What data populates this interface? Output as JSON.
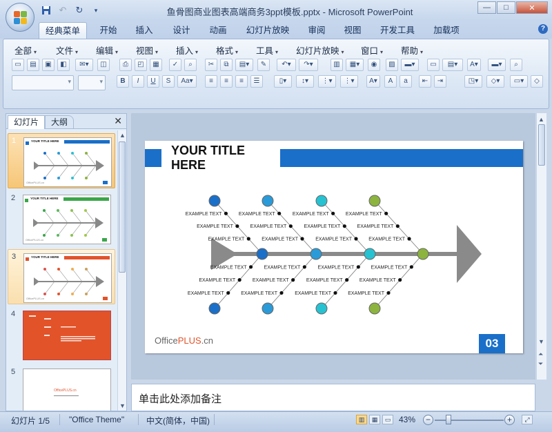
{
  "window": {
    "title": "鱼骨图商业图表高端商务3ppt模板.pptx - Microsoft PowerPoint",
    "controls": [
      "—",
      "□",
      "✕"
    ]
  },
  "ribbon_tabs": [
    "经典菜单",
    "开始",
    "插入",
    "设计",
    "动画",
    "幻灯片放映",
    "审阅",
    "视图",
    "开发工具",
    "加载项"
  ],
  "active_tab": "经典菜单",
  "menu_bar": [
    "全部",
    "文件",
    "编辑",
    "视图",
    "插入",
    "格式",
    "工具",
    "幻灯片放映",
    "窗口",
    "帮助"
  ],
  "pane": {
    "tabs": [
      "幻灯片",
      "大纲"
    ],
    "close_glyph": "✕",
    "thumbnails": [
      {
        "num": "1",
        "accent": "#1a6fc9",
        "title": "YOUR TITLE HERE",
        "logo": "OfficePLUS.cn"
      },
      {
        "num": "2",
        "accent": "#3aa64a",
        "title": "YOUR TITLE HERE",
        "logo": "OfficePLUS.cn"
      },
      {
        "num": "3",
        "accent": "#e2532a",
        "title": "YOUR TITLE HERE",
        "logo": "OfficePLUS.cn"
      },
      {
        "num": "4",
        "accent": "#e2532a",
        "title": "",
        "logo": ""
      },
      {
        "num": "5",
        "accent": "#ffffff",
        "title": "",
        "logo": "OfficePLUS.cn"
      }
    ]
  },
  "slide": {
    "title_line1": "YOUR TITLE",
    "title_line2": "HERE",
    "accent_color": "#1a6fc9",
    "bone_color": "#8a8a8a",
    "label": "EXAMPLE TEXT",
    "logo_prefix": "Office",
    "logo_accent": "PLUS",
    "logo_suffix": ".cn",
    "page_number": "03",
    "node_colors": [
      "#1a6fc9",
      "#2a9bd8",
      "#27c2d2",
      "#8cb43e"
    ],
    "spine_node_colors": [
      "#1a6fc9",
      "#2a9bd8",
      "#27c2d2",
      "#8cb43e"
    ]
  },
  "notes_placeholder": "单击此处添加备注",
  "status": {
    "slide_info": "幻灯片 1/5",
    "theme": "\"Office Theme\"",
    "language": "中文(简体，中国)",
    "zoom": "43%"
  }
}
